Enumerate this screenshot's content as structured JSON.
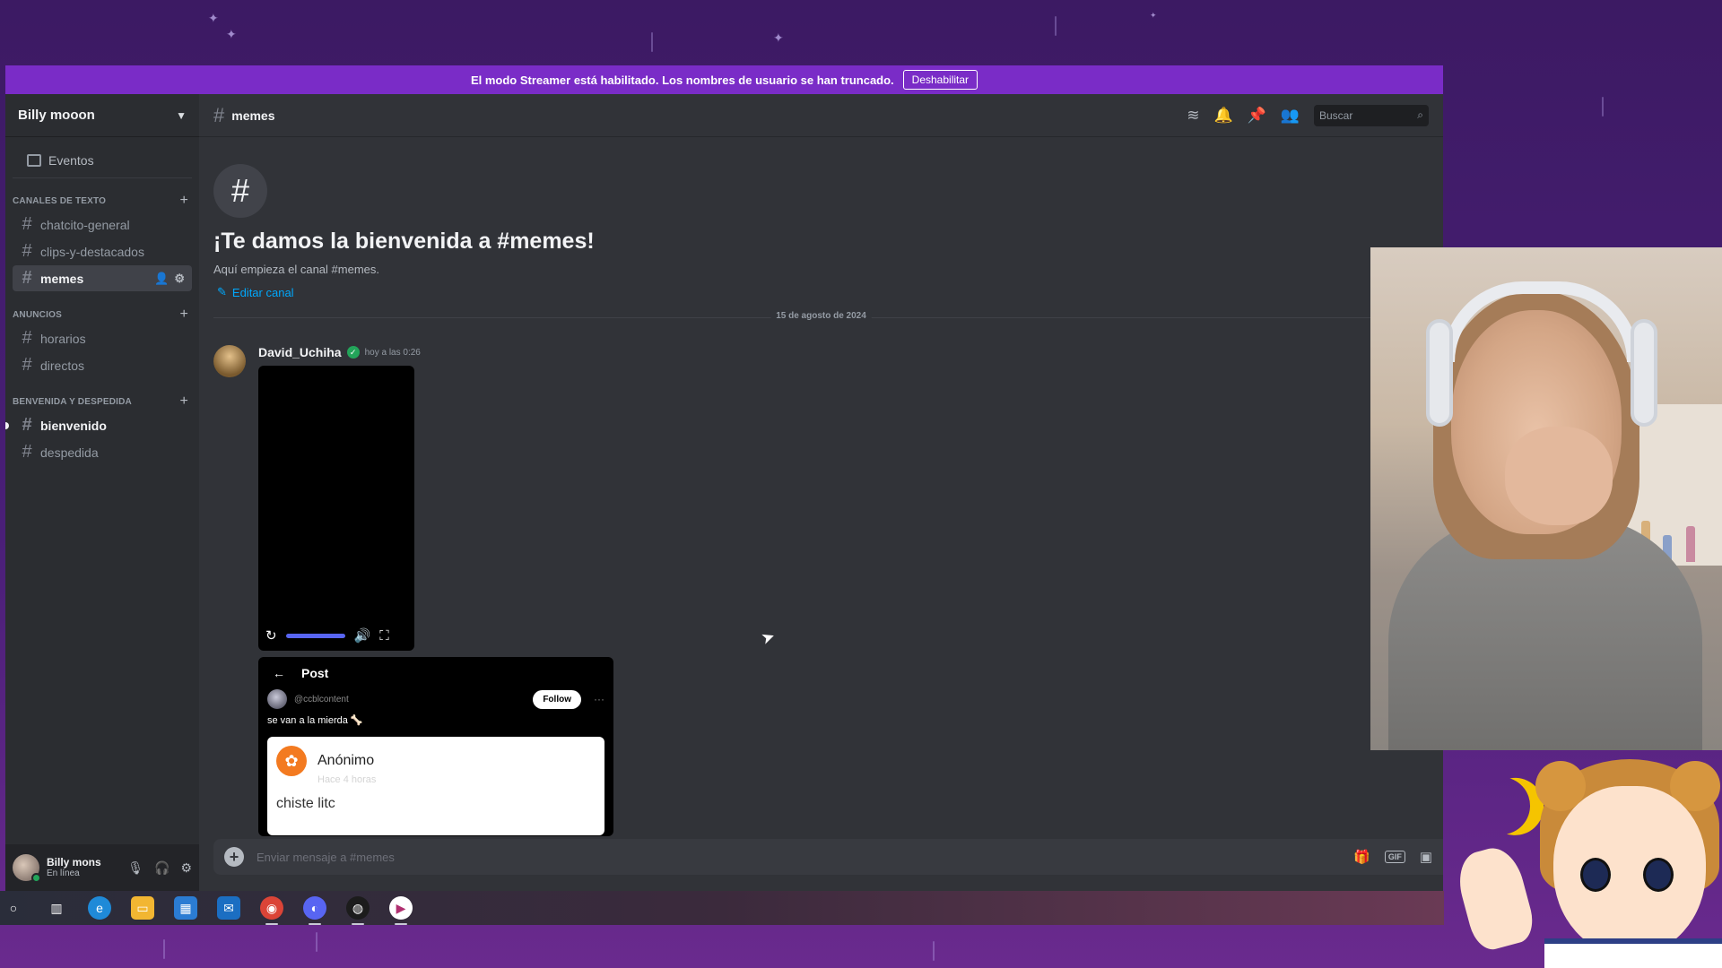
{
  "banner": {
    "text": "El modo Streamer está habilitado. Los nombres de usuario se han truncado.",
    "button_label": "Deshabilitar"
  },
  "server": {
    "name": "Billy mooon",
    "events_label": "Eventos"
  },
  "categories": [
    {
      "label": "CANALES DE TEXTO",
      "channels": [
        "chatcito-general",
        "clips-y-destacados",
        "memes"
      ]
    },
    {
      "label": "ANUNCIOS",
      "channels": [
        "horarios",
        "directos"
      ]
    },
    {
      "label": "BENVENIDA Y DESPEDIDA",
      "channels": [
        "bienvenido",
        "despedida"
      ]
    }
  ],
  "channel": {
    "name": "memes",
    "search_placeholder": "Buscar"
  },
  "welcome": {
    "title": "¡Te damos la bienvenida a #memes!",
    "subtitle": "Aquí empieza el canal #memes.",
    "edit_label": "Editar canal"
  },
  "date_divider": "15 de agosto de 2024",
  "message": {
    "author": "David_Uchiha",
    "timestamp": "hoy a las 0:26",
    "video": {
      "volume": 1.0
    },
    "post": {
      "header": "Post",
      "handle": "@ccblcontent",
      "follow_label": "Follow",
      "caption": "se van a la mierda 🦴",
      "card_name": "Anónimo",
      "card_faint": "Hace 4 horas",
      "card_body": "chiste litc"
    }
  },
  "composer": {
    "placeholder": "Enviar mensaje a #memes",
    "gif_label": "GIF"
  },
  "user": {
    "name": "Billy mons",
    "status": "En línea"
  },
  "colors": {
    "banner": "#7a2cc7",
    "accent": "#5865f2",
    "link": "#00a8fc",
    "online": "#23a55a"
  }
}
